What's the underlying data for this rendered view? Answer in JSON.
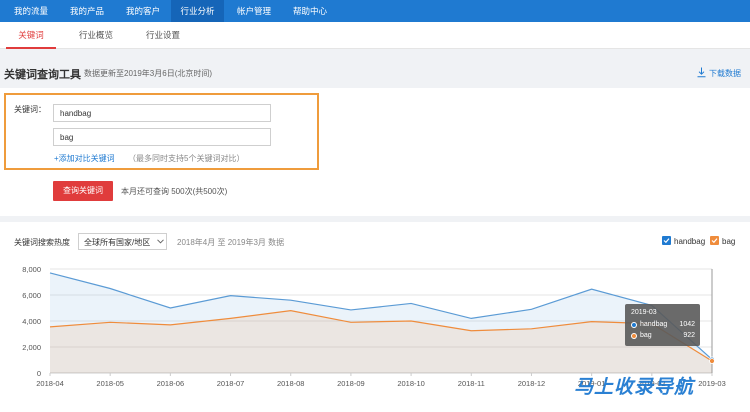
{
  "topnav": {
    "items": [
      "我的流量",
      "我的产品",
      "我的客户",
      "行业分析",
      "帐户管理",
      "帮助中心"
    ],
    "active": "行业分析"
  },
  "subnav": {
    "tabs": [
      "关键词",
      "行业概览",
      "行业设置"
    ],
    "active": "关键词"
  },
  "tool": {
    "title": "关键词查询工具",
    "update_note": "数据更新至2019年3月6日(北京时间)",
    "download_label": "下载数据"
  },
  "query": {
    "keyword_label": "关键词：",
    "keywords": [
      "handbag",
      "bag"
    ],
    "add_link": "+添加对比关键词",
    "add_hint": "（最多同时支持5个关键词对比）",
    "submit_label": "查询关键词",
    "quota_text": "本月还可查询 500次(共500次)"
  },
  "chart_panel": {
    "label": "关键词搜索热度",
    "region": "全球所有国家/地区",
    "date_range": "2018年4月 至 2019年3月 数据",
    "legend": [
      {
        "name": "handbag",
        "color": "#1f7ad1",
        "checked": true
      },
      {
        "name": "bag",
        "color": "#ef8c3c",
        "checked": true
      }
    ]
  },
  "chart_data": {
    "type": "area",
    "x": [
      "2018-04",
      "2018-05",
      "2018-06",
      "2018-07",
      "2018-08",
      "2018-09",
      "2018-10",
      "2018-11",
      "2018-12",
      "2019-01",
      "2019-02",
      "2019-03"
    ],
    "x_tick_labels": [
      "2018-04",
      "2018-05",
      "2018-06",
      "2018-07",
      "2018-08",
      "2018-09",
      "2018-10",
      "2018-11",
      "2018-12",
      "2019-01",
      "2019-02",
      "2019-03"
    ],
    "y_ticks": [
      "0",
      "2,000",
      "4,000",
      "6,000",
      "8,000"
    ],
    "ylim": [
      0,
      8000
    ],
    "grid": true,
    "series": [
      {
        "name": "handbag",
        "color": "#5b9bd5",
        "values": [
          7700,
          6500,
          5000,
          5950,
          5600,
          4850,
          5350,
          4200,
          4900,
          6450,
          5200,
          1042
        ]
      },
      {
        "name": "bag",
        "color": "#ef8c3c",
        "values": [
          3550,
          3900,
          3700,
          4200,
          4800,
          3900,
          4000,
          3250,
          3400,
          3950,
          3800,
          922
        ]
      }
    ],
    "tooltip": {
      "title": "2019-03",
      "rows": [
        {
          "name": "handbag",
          "value": "1042"
        },
        {
          "name": "bag",
          "value": "922"
        }
      ]
    }
  },
  "watermark": "马上收录导航"
}
